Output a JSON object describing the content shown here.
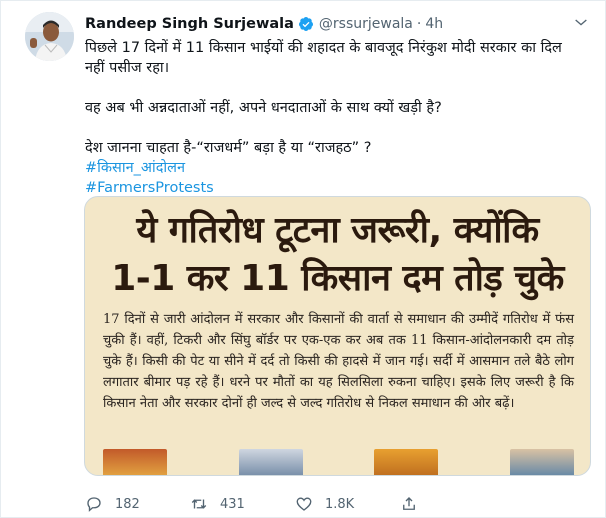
{
  "tweet": {
    "author_name": "Randeep Singh Surjewala",
    "handle": "@rssurjewala",
    "separator": "·",
    "time": "4h",
    "lines": [
      "पिछले 17 दिनों में 11 किसान भाईयों की शहादत के बावजूद निरंकुश मोदी सरकार का दिल नहीं पसीज रहा।",
      "वह अब भी अन्नदाताओं नहीं, अपने धनदाताओं के साथ क्यों खड़ी है?",
      "देश जानना चाहता है-“राजधर्म” बड़ा है या “राजहठ” ?"
    ],
    "hashtags": [
      "#किसान_आंदोलन",
      "#FarmersProtests"
    ]
  },
  "media": {
    "headline_line1": "ये गतिरोध टूटना जरूरी, क्योंकि",
    "headline_line2": "1-1 कर 11 किसान दम तोड़ चुके",
    "article_text": "17 दिनों से जारी आंदोलन में सरकार और किसानों की वार्ता से समाधान की उम्मीदें गतिरोध में फंस चुकी हैं। वहीं, टिकरी और सिंघु बॉर्डर पर एक-एक कर अब तक 11 किसान-आंदोलनकारी दम तोड़ चुके हैं। किसी की पेट या सीने में दर्द तो किसी की हादसे में जान गई। सर्दी में आसमान तले बैठे लोग लगातार बीमार पड़ रहे हैं। धरने पर मौतों का यह सिलसिला रुकना चाहिए। इसके लिए जरूरी है कि किसान नेता और सरकार दोनों ही जल्द से जल्द गतिरोध से निकल समाधान की ओर बढ़ें।"
  },
  "actions": {
    "replies": "182",
    "retweets": "431",
    "likes": "1.8K"
  },
  "colors": {
    "accent": "#1b95e0",
    "verified": "#1da1f2",
    "muted": "#536471"
  },
  "icons": [
    "verified-badge-icon",
    "more-options-icon",
    "reply-icon",
    "retweet-icon",
    "like-icon",
    "share-icon"
  ]
}
